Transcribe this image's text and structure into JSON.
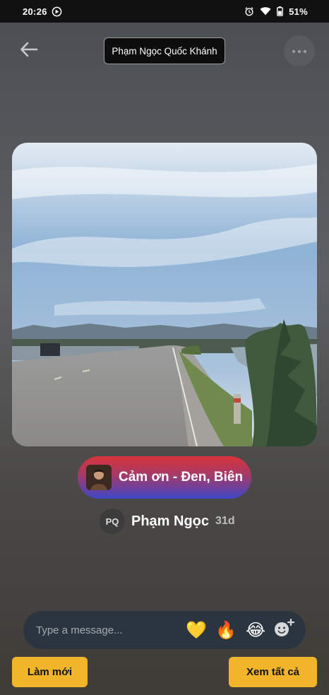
{
  "status_bar": {
    "time": "20:26",
    "battery": "51%"
  },
  "header": {
    "title": "Phạm Ngọc Quốc Khánh"
  },
  "music": {
    "title": "Cảm ơn - Đen, Biên"
  },
  "author": {
    "initials": "PQ",
    "name": "Phạm Ngọc",
    "time_ago": "31d"
  },
  "message_bar": {
    "placeholder": "Type a message...",
    "reactions": [
      "💛",
      "🔥",
      "😂"
    ]
  },
  "actions": {
    "refresh_label": "Làm mới",
    "see_all_label": "Xem tất cả"
  },
  "colors": {
    "accent": "#f2b52a",
    "message_bar": "#2b3540"
  }
}
